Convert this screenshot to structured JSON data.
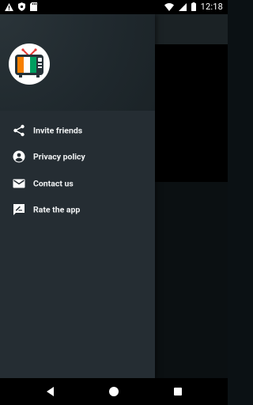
{
  "status_bar": {
    "time": "12:18",
    "left_icons": [
      "warning-icon",
      "shield-icon",
      "sd-card-icon"
    ],
    "right_icons": [
      "wifi-icon",
      "cellular-icon",
      "battery-icon"
    ]
  },
  "drawer": {
    "logo_icon": "tv-flag-logo-icon",
    "items": [
      {
        "label": "Invite friends",
        "icon": "share-icon"
      },
      {
        "label": "Privacy policy",
        "icon": "account-circle-icon"
      },
      {
        "label": "Contact us",
        "icon": "mail-icon"
      },
      {
        "label": "Rate the app",
        "icon": "rate-review-icon"
      }
    ]
  },
  "nav_bar": {
    "buttons": [
      "back-button",
      "home-button",
      "recents-button"
    ]
  },
  "colors": {
    "drawer_bg": "#252d33",
    "header_bg": "#1f282d",
    "text": "#f2f4f5",
    "flag_orange": "#f77f00",
    "flag_white": "#ffffff",
    "flag_green": "#009e60"
  }
}
